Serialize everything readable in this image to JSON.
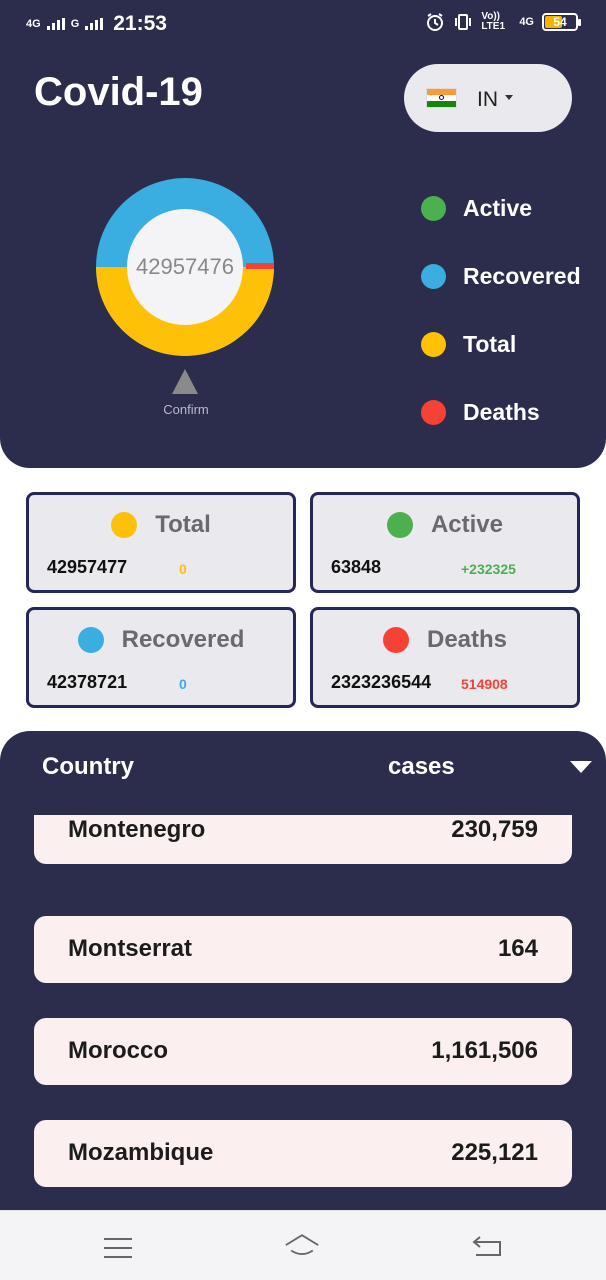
{
  "status_bar": {
    "net1": "4G",
    "net2": "G",
    "time": "21:53",
    "volte": "Vo)) LTE1",
    "net3": "4G",
    "battery": "54"
  },
  "header": {
    "title": "Covid-19",
    "country_code": "IN",
    "donut_value": "42957476",
    "confirm_label": "Confirm"
  },
  "legend": [
    {
      "label": "Active",
      "color": "#4caf50"
    },
    {
      "label": "Recovered",
      "color": "#3aaee0"
    },
    {
      "label": "Total",
      "color": "#ffc107"
    },
    {
      "label": "Deaths",
      "color": "#f44336"
    }
  ],
  "donut_chart": {
    "total_color": "#ffc107",
    "recovered_color": "#3aaee0",
    "deaths_color": "#f44336",
    "inner_color": "#f4f4f6"
  },
  "cards": {
    "total": {
      "title": "Total",
      "value": "42957477",
      "delta": "0",
      "color": "#ffc107",
      "delta_color": "#ffc107"
    },
    "active": {
      "title": "Active",
      "value": "63848",
      "delta": "+232325",
      "color": "#4caf50",
      "delta_color": "#4caf50"
    },
    "recovered": {
      "title": "Recovered",
      "value": "42378721",
      "delta": "0",
      "color": "#3aaee0",
      "delta_color": "#3aaee0"
    },
    "deaths": {
      "title": "Deaths",
      "value": "2323236544",
      "delta": "514908",
      "color": "#f44336",
      "delta_color": "#f44336"
    }
  },
  "list": {
    "col_country": "Country",
    "col_cases": "cases",
    "rows": [
      {
        "country": "Montenegro",
        "cases": "230,759"
      },
      {
        "country": "Montserrat",
        "cases": "164"
      },
      {
        "country": "Morocco",
        "cases": "1,161,506"
      },
      {
        "country": "Mozambique",
        "cases": "225,121"
      }
    ]
  },
  "icons": {
    "menu": "menu-icon",
    "home": "home-icon",
    "back": "back-icon"
  }
}
